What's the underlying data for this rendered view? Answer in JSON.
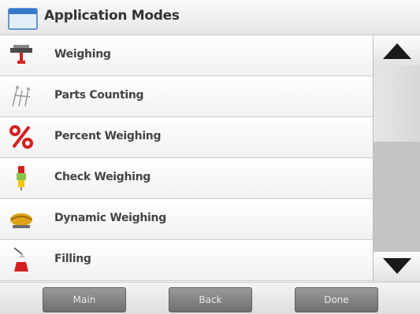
{
  "header": {
    "title": "Application Modes",
    "icon": "window-icon"
  },
  "modes": [
    {
      "label": "Weighing",
      "icon": "weighing-scale-icon"
    },
    {
      "label": "Parts Counting",
      "icon": "parts-counting-icon"
    },
    {
      "label": "Percent Weighing",
      "icon": "percent-icon"
    },
    {
      "label": "Check Weighing",
      "icon": "check-weighing-light-icon"
    },
    {
      "label": "Dynamic Weighing",
      "icon": "dynamic-weighing-icon"
    },
    {
      "label": "Filling",
      "icon": "filling-icon"
    }
  ],
  "scrollbar": {
    "up_icon": "arrow-up-icon",
    "down_icon": "arrow-down-icon",
    "position": 0
  },
  "footer": {
    "main_label": "Main",
    "back_label": "Back",
    "done_label": "Done"
  },
  "colors": {
    "accent_red": "#d42020",
    "icon_blue": "#3a78c8",
    "button_gray": "#808080"
  }
}
